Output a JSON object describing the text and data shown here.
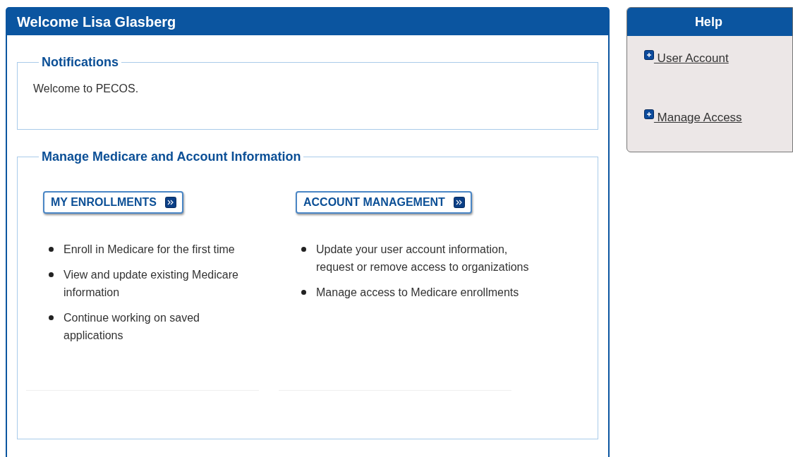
{
  "main": {
    "title": "Welcome Lisa Glasberg",
    "notifications": {
      "legend": "Notifications",
      "message": "Welcome to PECOS."
    },
    "manage": {
      "legend": "Manage Medicare and Account Information",
      "columns": [
        {
          "button": "MY ENROLLMENTS",
          "bullets": [
            "Enroll in Medicare for the first time",
            "View and update existing Medicare information",
            "Continue working on saved applications"
          ]
        },
        {
          "button": "ACCOUNT MANAGEMENT",
          "bullets": [
            "Update your user account information, request or remove access to organizations",
            "Manage access to Medicare enrollments"
          ]
        }
      ]
    }
  },
  "help": {
    "title": "Help",
    "links": [
      "User Account",
      "Manage Access"
    ]
  }
}
